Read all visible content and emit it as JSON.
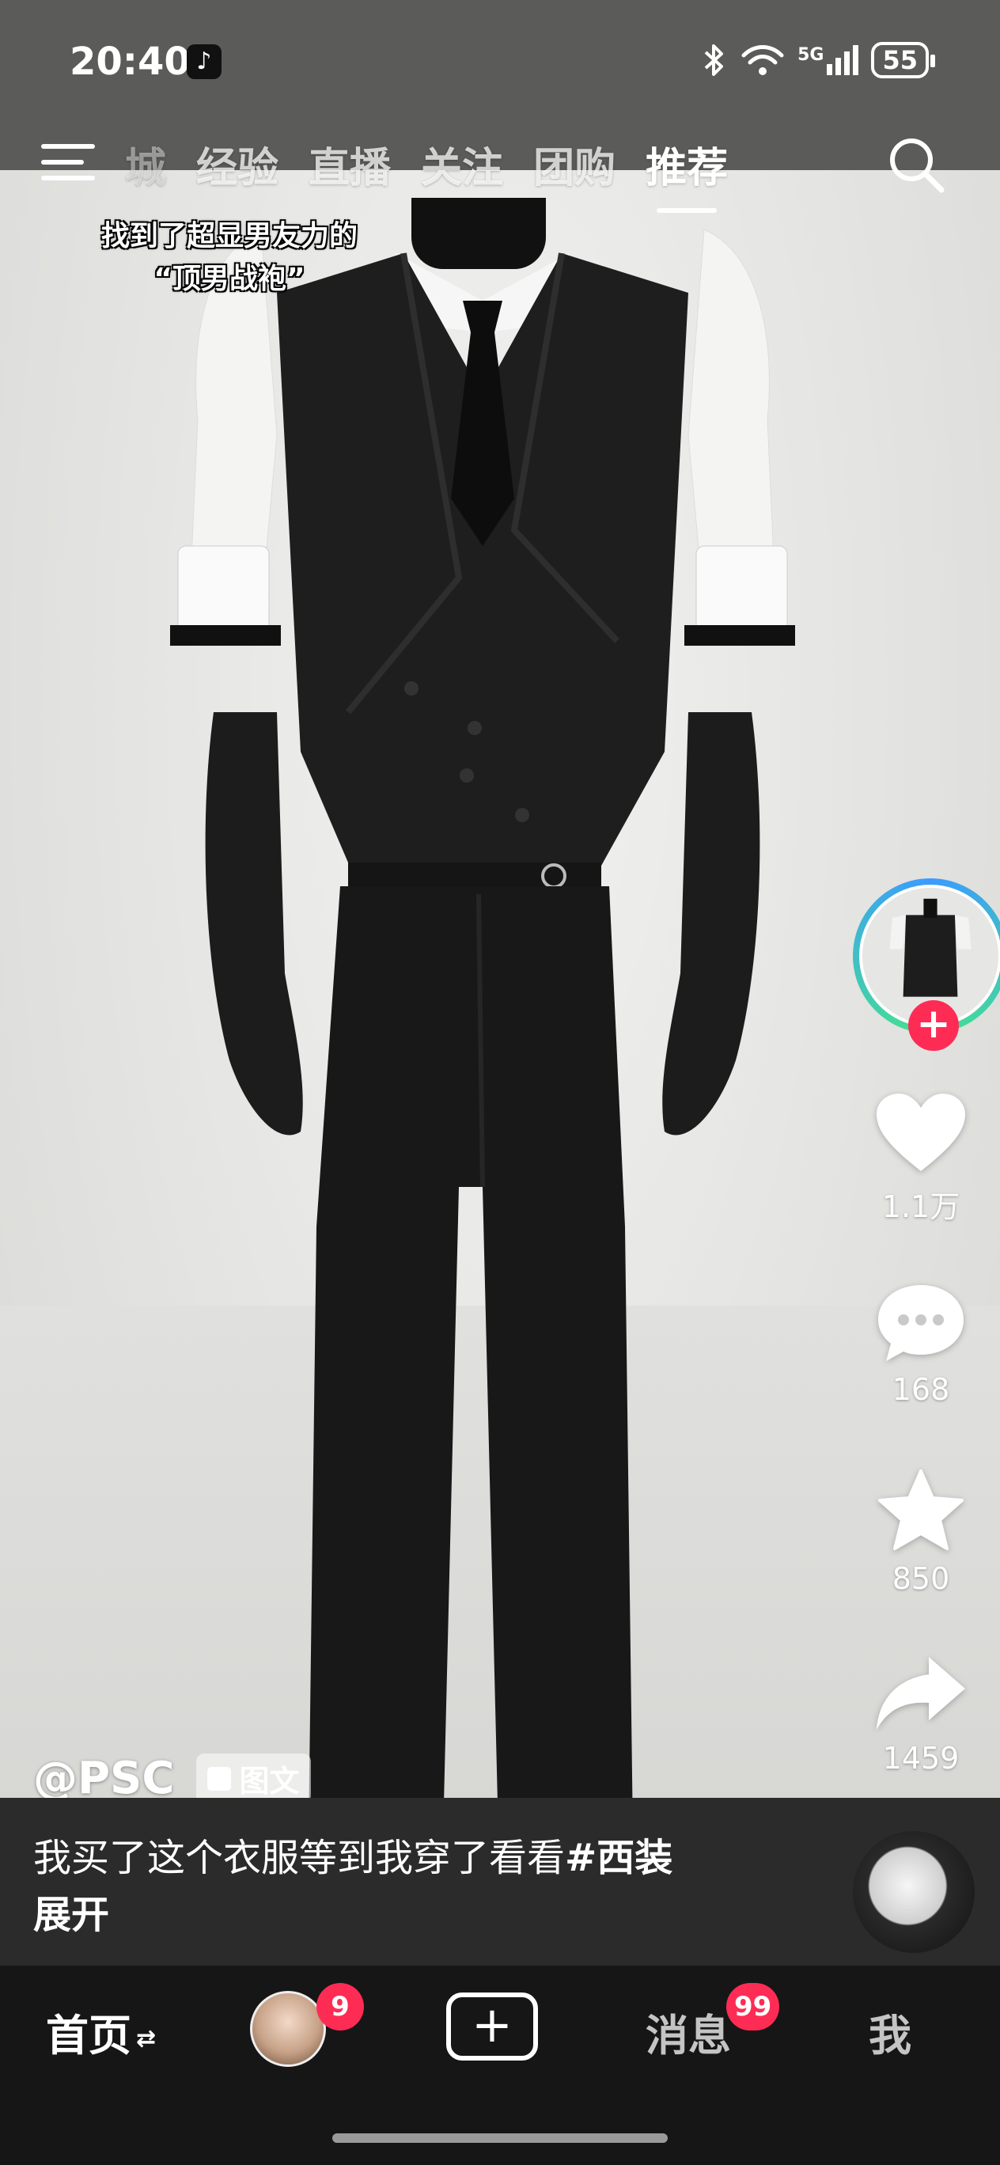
{
  "status_bar": {
    "time": "20:40",
    "network": "5G",
    "battery": "55"
  },
  "top_nav": {
    "tabs": [
      {
        "label": "商城"
      },
      {
        "label": "经验"
      },
      {
        "label": "直播"
      },
      {
        "label": "关注"
      },
      {
        "label": "团购"
      },
      {
        "label": "推荐"
      }
    ],
    "active_tab": "推荐",
    "first_tab_visible": "城"
  },
  "video": {
    "caption_line1": "找到了超显男友力的",
    "caption_line2": "“顶男战袍”"
  },
  "rail": {
    "like_count": "1.1万",
    "comment_count": "168",
    "favorite_count": "850",
    "share_count": "1459",
    "follow_symbol": "+"
  },
  "post": {
    "author": "@PSC",
    "type_badge": "图文",
    "description": "我买了这个衣服等到我穿了看看",
    "hashtag": "#西装",
    "expand_label": "展开"
  },
  "bottom_nav": {
    "home": "首页",
    "home_swap": "⇄",
    "friends_badge": "9",
    "create_symbol": "+",
    "messages": "消息",
    "messages_badge": "99",
    "me": "我"
  },
  "colors": {
    "accent_red": "#fe2c55",
    "panel": "#2b2b2b",
    "nav_bg": "#161616"
  }
}
